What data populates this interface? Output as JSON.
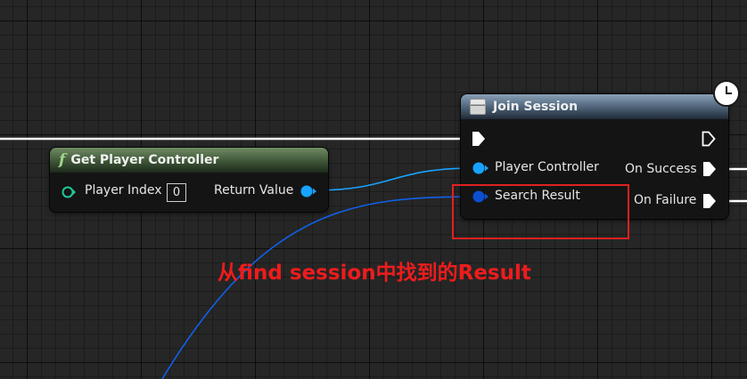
{
  "get_player_controller": {
    "title": "Get Player Controller",
    "icon": "function-icon",
    "input_label": "Player Index",
    "input_value": "0",
    "output_label": "Return Value"
  },
  "join_session": {
    "title": "Join Session",
    "icon": "struct-node-icon",
    "inputs": [
      "Player Controller",
      "Search Result"
    ],
    "outputs": [
      "On Success",
      "On Failure"
    ],
    "latent_icon": "clock-icon"
  },
  "annotation": {
    "text": "从find session中找到的Result",
    "color": "#ee1c1c"
  },
  "colors": {
    "exec_wire": "#ffffff",
    "object_pin": "#17a3ff",
    "struct_pin": "#0a4fcf",
    "function_header": "#3e5537",
    "event_header": "#4b6076"
  }
}
